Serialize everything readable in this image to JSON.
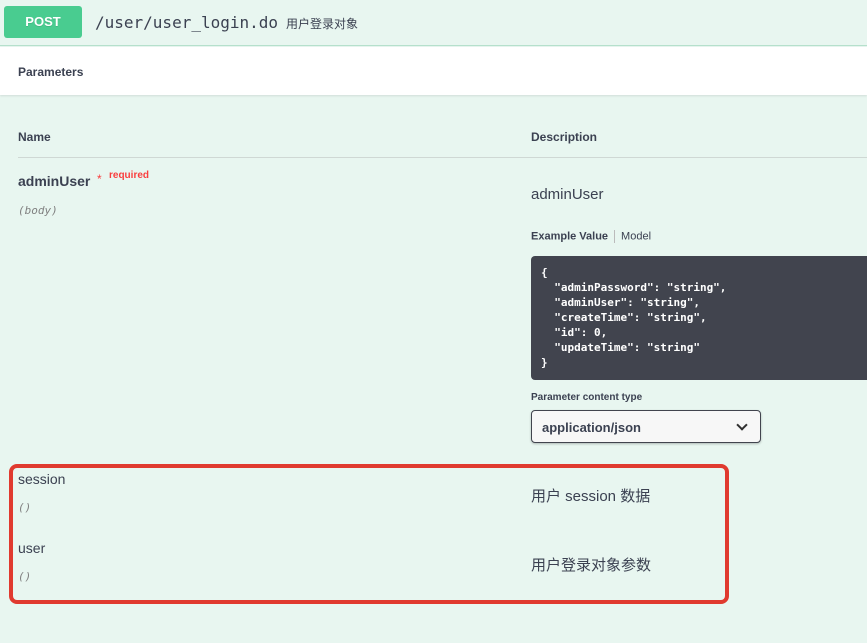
{
  "operation": {
    "method": "POST",
    "path": "/user/user_login.do",
    "summary": "用户登录对象"
  },
  "parameters_section": {
    "title": "Parameters",
    "name_header": "Name",
    "description_header": "Description"
  },
  "params": [
    {
      "name": "adminUser",
      "required_star": "*",
      "required_label": "required",
      "in": "(body)",
      "description": "adminUser",
      "example_tab": "Example Value",
      "model_tab": "Model",
      "example_code": "{\n  \"adminPassword\": \"string\",\n  \"adminUser\": \"string\",\n  \"createTime\": \"string\",\n  \"id\": 0,\n  \"updateTime\": \"string\"\n}",
      "content_type_label": "Parameter content type",
      "content_type_value": "application/json"
    },
    {
      "name": "session",
      "in": "()",
      "description": "用户 session 数据"
    },
    {
      "name": "user",
      "in": "()",
      "description": "用户登录对象参数"
    }
  ],
  "colors": {
    "post_green": "#49cc90",
    "background": "#e8f6f0",
    "required_red": "#f93e3e",
    "highlight_red": "#e03a2f",
    "code_bg": "#41444e"
  }
}
